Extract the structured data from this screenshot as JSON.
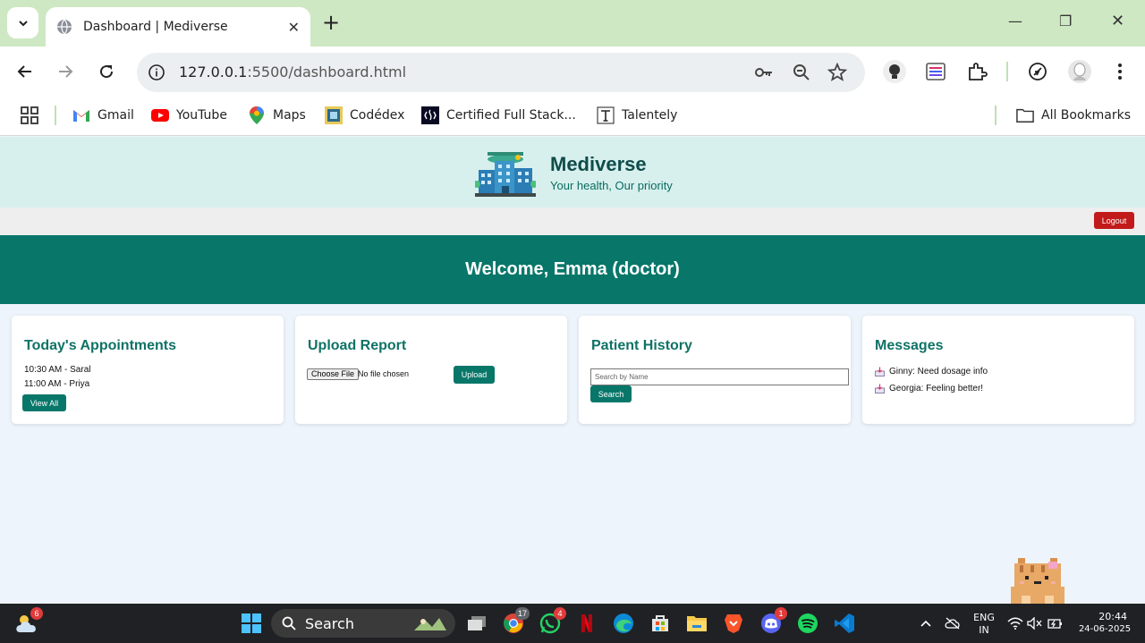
{
  "browser": {
    "tab_title": "Dashboard | Mediverse",
    "url_host": "127.0.0.1",
    "url_rest": ":5500/dashboard.html",
    "bookmarks": [
      {
        "label": "Gmail",
        "icon": "gmail-icon"
      },
      {
        "label": "YouTube",
        "icon": "youtube-icon"
      },
      {
        "label": "Maps",
        "icon": "maps-icon"
      },
      {
        "label": "Codédex",
        "icon": "codedex-icon"
      },
      {
        "label": "Certified Full Stack...",
        "icon": "freecodecamp-icon"
      },
      {
        "label": "Talentely",
        "icon": "talentely-icon"
      }
    ],
    "all_bookmarks": "All Bookmarks"
  },
  "site": {
    "brand": "Mediverse",
    "tagline": "Your health, Our priority",
    "logout_label": "Logout",
    "welcome": "Welcome, Emma (doctor)"
  },
  "cards": {
    "appointments": {
      "title": "Today's Appointments",
      "items": [
        "10:30 AM - Saral",
        "11:00 AM - Priya"
      ],
      "button": "View All"
    },
    "upload": {
      "title": "Upload Report",
      "choose_file": "Choose File",
      "file_status": "No file chosen",
      "button": "Upload"
    },
    "history": {
      "title": "Patient History",
      "placeholder": "Search by Name",
      "button": "Search"
    },
    "messages": {
      "title": "Messages",
      "items": [
        "Ginny: Need dosage info",
        "Georgia: Feeling better!"
      ]
    }
  },
  "taskbar": {
    "search_label": "Search",
    "weather_badge": "6",
    "chrome_badge": "17",
    "whatsapp_badge": "4",
    "discord_badge": "1",
    "lang_top": "ENG",
    "lang_bottom": "IN",
    "time": "20:44",
    "date": "24-06-2025"
  },
  "colors": {
    "tabstrip": "#cfe8c4",
    "header_bg": "#d7f0ee",
    "welcome_bg": "#08776a",
    "card_title": "#0f7266",
    "logout": "#c21a1a",
    "page_bg": "#eef4fb"
  }
}
